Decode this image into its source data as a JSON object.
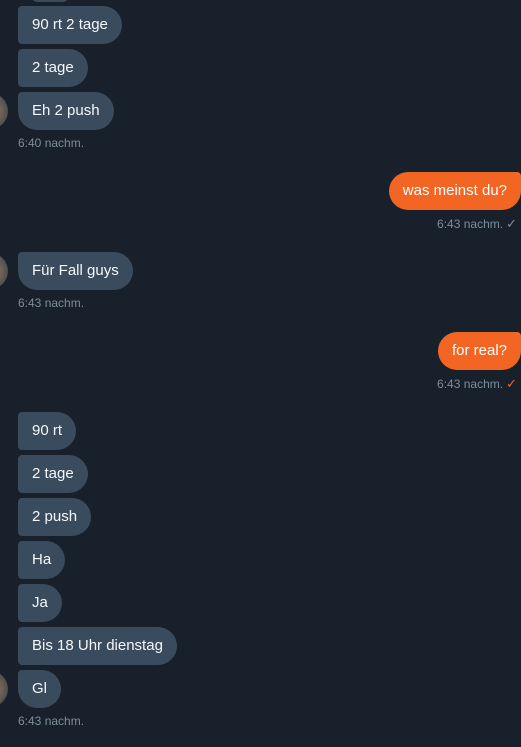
{
  "messages_block_1": {
    "bubbles": [
      "90 rt 2 tage",
      "2 tage",
      "Eh 2 push"
    ],
    "time": "6:40 nachm."
  },
  "outgoing_1": {
    "text": "was meinst du?",
    "time": "6:43 nachm.",
    "check": "✓"
  },
  "messages_block_2": {
    "bubbles": [
      "Für Fall guys"
    ],
    "time": "6:43 nachm."
  },
  "outgoing_2": {
    "text": "for real?",
    "time": "6:43 nachm.",
    "check": "✓"
  },
  "messages_block_3": {
    "bubbles": [
      "90 rt",
      "2 tage",
      "2 push",
      "Ha",
      "Ja",
      "Bis 18 Uhr dienstag",
      "Gl"
    ],
    "time": "6:43 nachm."
  }
}
